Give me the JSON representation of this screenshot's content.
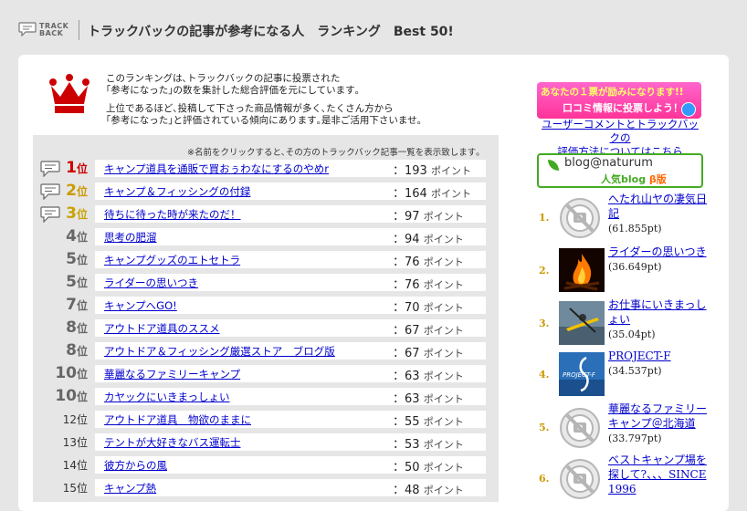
{
  "header": {
    "logo_line1": "TRACK",
    "logo_line2": "BACK",
    "title": "トラックバックの記事が参考になる人　ランキング　Best 50!"
  },
  "intro": {
    "line1": "このランキングは､トラックバックの記事に投票された",
    "line2": "｢参考になった｣の数を集計した総合評価を元にしています｡",
    "line3": "上位であるほど､投稿して下さった商品情報が多く､たくさん方から",
    "line4": "｢参考になった｣と評価されている傾向にあります｡是非ご活用下さいませ｡"
  },
  "note": "※名前をクリックすると､その方のトラックバック記事一覧を表示致します｡",
  "points_label": "ポイント",
  "rank_unit": "位",
  "rankings": [
    {
      "rank": "1",
      "title": "キャンプ道具を通販で買おぅわなにするのやめr",
      "points": "193"
    },
    {
      "rank": "2",
      "title": "キャンプ＆フィッシングの付録",
      "points": "164"
    },
    {
      "rank": "3",
      "title": "待ちに待った時が来たのだ！",
      "points": "97"
    },
    {
      "rank": "4",
      "title": "思考の肥溜",
      "points": "94"
    },
    {
      "rank": "5",
      "title": "キャンプグッズのエトセトラ",
      "points": "76"
    },
    {
      "rank": "5",
      "title": "ライダーの思いつき",
      "points": "76"
    },
    {
      "rank": "7",
      "title": "キャンプへGO!",
      "points": "70"
    },
    {
      "rank": "8",
      "title": "アウトドア道具のススメ",
      "points": "67"
    },
    {
      "rank": "8",
      "title": "アウトドア＆フィッシング厳選ストア　ブログ版",
      "points": "67"
    },
    {
      "rank": "10",
      "title": "華麗なるファミリーキャンプ",
      "points": "63"
    },
    {
      "rank": "10",
      "title": "カヤックにいきまっしょい",
      "points": "63"
    },
    {
      "rank": "12",
      "title": "アウトドア道具　物欲のままに",
      "points": "55"
    },
    {
      "rank": "13",
      "title": "テントが大好きなバス運転士",
      "points": "53"
    },
    {
      "rank": "14",
      "title": "彼方からの風",
      "points": "50"
    },
    {
      "rank": "15",
      "title": "キャンプ熱",
      "points": "48"
    }
  ],
  "promo": {
    "line1": "あなたの１票が励みになります!!",
    "line2": "口コミ情報に投票しよう！",
    "link": "ユーザーコメントとトラックバックの評価方法についてはこちら",
    "link_line1": "ユーザーコメントとトラックバックの",
    "link_line2": "評価方法についてはこちら"
  },
  "naturum": {
    "name": "blog@naturum",
    "sub": "人気blog",
    "beta": "β版"
  },
  "blogs": [
    {
      "num": "1.",
      "title": "へたれ山ヤの凄気日記",
      "score": "(61.855pt)"
    },
    {
      "num": "2.",
      "title": "ライダーの思いつき",
      "score": "(36.649pt)"
    },
    {
      "num": "3.",
      "title": "お仕事にいきまっしょい",
      "score": "(35.04pt)"
    },
    {
      "num": "4.",
      "title": "PROJECT-F",
      "score": "(34.537pt)"
    },
    {
      "num": "5.",
      "title": "華麗なるファミリーキャンプ＠北海道",
      "score": "(33.797pt)"
    },
    {
      "num": "6.",
      "title": "ベストキャンプ場を探して?、、、SINCE 1996",
      "score": ""
    }
  ],
  "thumb4_text": "PROJECT-F",
  "colors": {
    "link": "#0000cc",
    "rank1": "#cc0000",
    "rank2": "#cc9900",
    "naturum_green": "#44aa22",
    "promo_pink": "#ff3399"
  }
}
